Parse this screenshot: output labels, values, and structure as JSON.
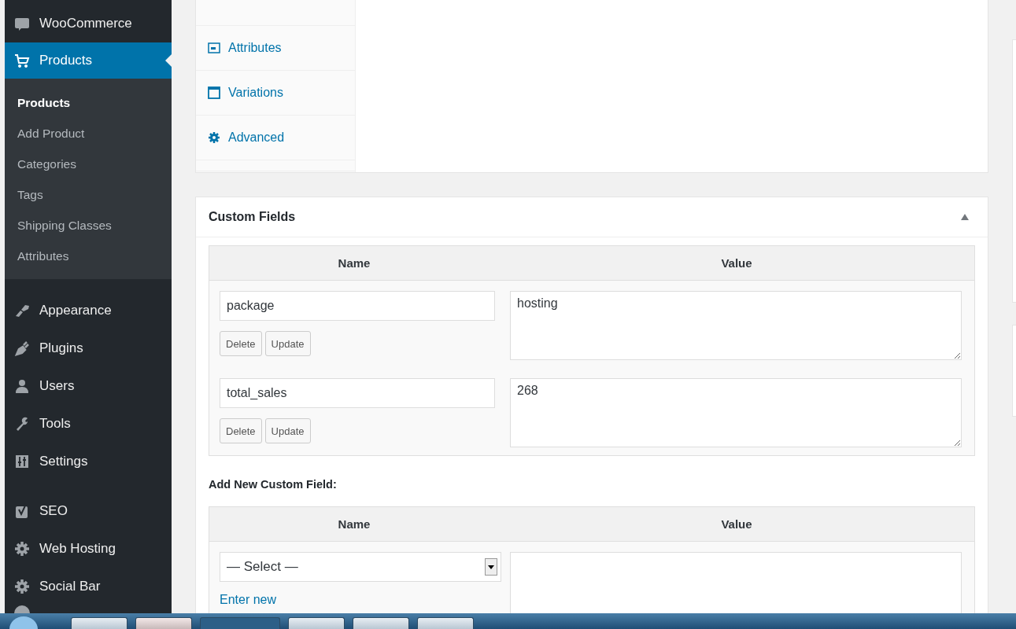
{
  "sidebar": {
    "items": [
      {
        "label": "WooCommerce",
        "selected": false
      },
      {
        "label": "Products",
        "selected": true,
        "children": [
          {
            "label": "Products",
            "selected": true
          },
          {
            "label": "Add Product",
            "selected": false
          },
          {
            "label": "Categories",
            "selected": false
          },
          {
            "label": "Tags",
            "selected": false
          },
          {
            "label": "Shipping Classes",
            "selected": false
          },
          {
            "label": "Attributes",
            "selected": false
          }
        ]
      },
      {
        "label": "Appearance",
        "selected": false
      },
      {
        "label": "Plugins",
        "selected": false
      },
      {
        "label": "Users",
        "selected": false
      },
      {
        "label": "Tools",
        "selected": false
      },
      {
        "label": "Settings",
        "selected": false
      },
      {
        "label": "SEO",
        "selected": false
      },
      {
        "label": "Web Hosting",
        "selected": false
      },
      {
        "label": "Social Bar",
        "selected": false
      }
    ]
  },
  "product_data": {
    "tabs": [
      {
        "label": "Attributes"
      },
      {
        "label": "Variations"
      },
      {
        "label": "Advanced"
      }
    ]
  },
  "custom_fields": {
    "title": "Custom Fields",
    "columns": [
      "Name",
      "Value"
    ],
    "rows": [
      {
        "name": "package",
        "value": "hosting",
        "buttons": [
          "Delete",
          "Update"
        ]
      },
      {
        "name": "total_sales",
        "value": "268",
        "buttons": [
          "Delete",
          "Update"
        ]
      }
    ],
    "add_new": {
      "heading": "Add New Custom Field:",
      "columns": [
        "Name",
        "Value"
      ],
      "select": "— Select —",
      "link": "Enter new"
    }
  }
}
